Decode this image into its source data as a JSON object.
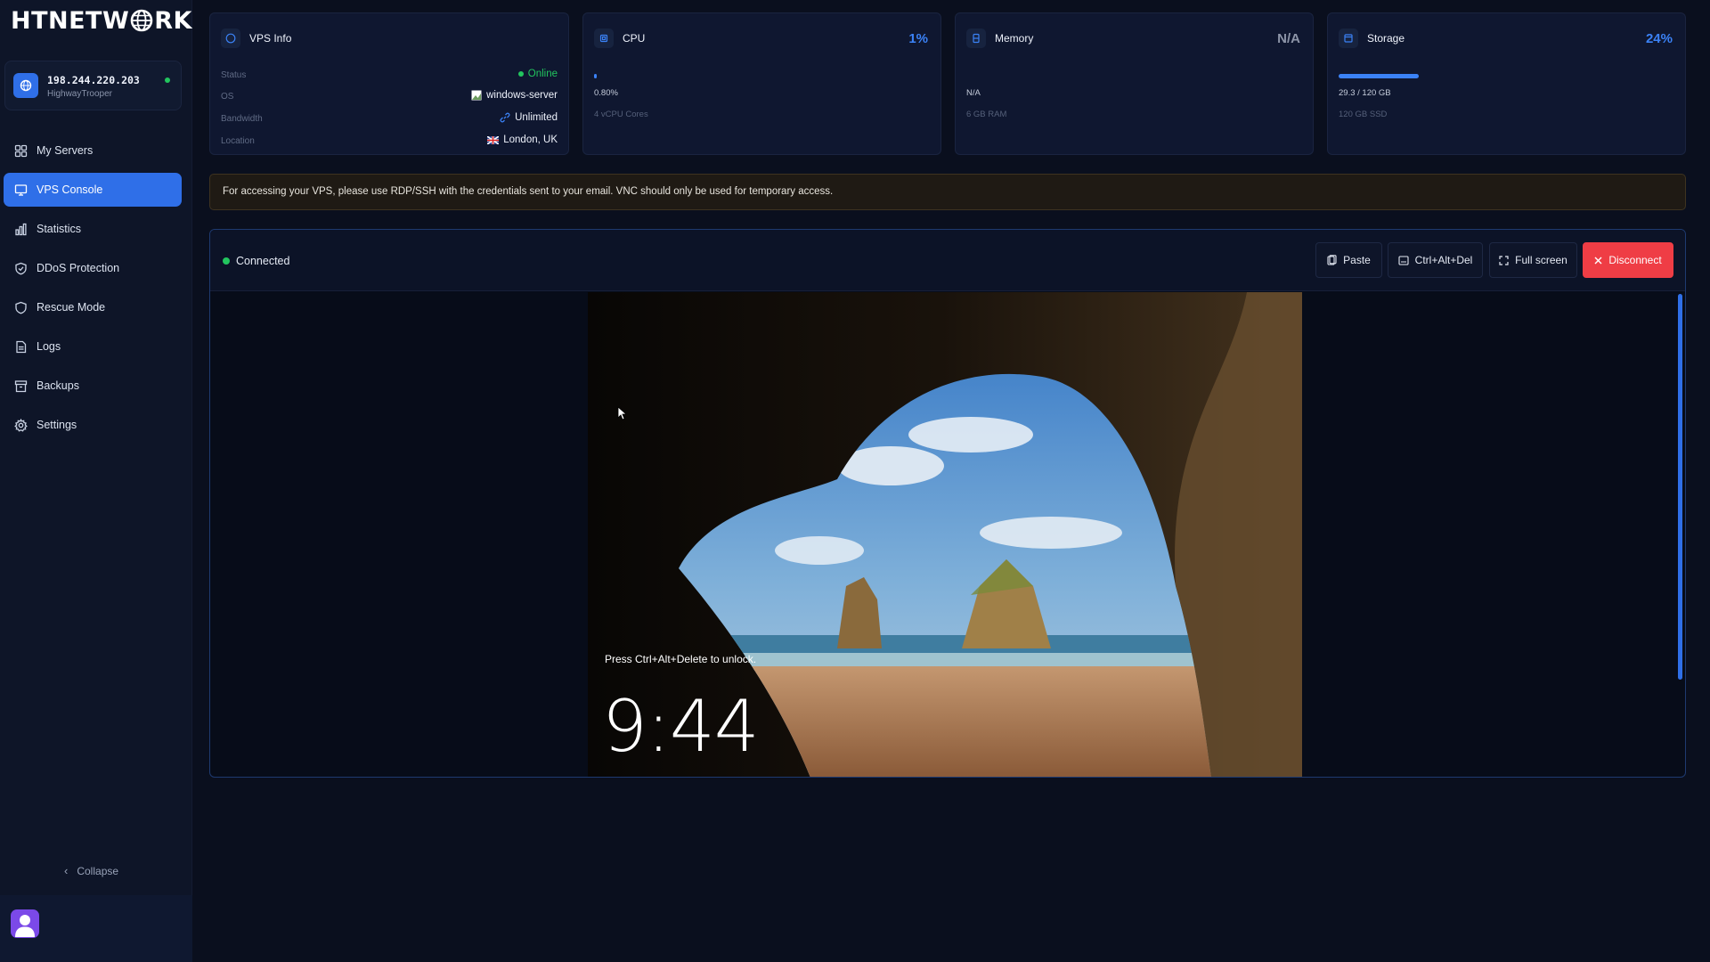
{
  "brand": {
    "logo_pre": "HTNETW",
    "logo_post": "RK"
  },
  "server": {
    "ip": "198.244.220.203",
    "hostname": "HighwayTrooper"
  },
  "nav": [
    {
      "label": "My Servers",
      "icon": "grid-icon"
    },
    {
      "label": "VPS Console",
      "icon": "monitor-icon",
      "active": true
    },
    {
      "label": "Statistics",
      "icon": "bar-chart-icon"
    },
    {
      "label": "DDoS Protection",
      "icon": "shield-icon"
    },
    {
      "label": "Rescue Mode",
      "icon": "shield-alert-icon"
    },
    {
      "label": "Logs",
      "icon": "file-icon"
    },
    {
      "label": "Backups",
      "icon": "archive-icon"
    },
    {
      "label": "Settings",
      "icon": "gear-icon"
    }
  ],
  "collapse_label": "Collapse",
  "vps_info": {
    "title": "VPS Info",
    "rows": [
      {
        "key": "Status",
        "value": "Online"
      },
      {
        "key": "OS",
        "value": "windows-server"
      },
      {
        "key": "Bandwidth",
        "value": "Unlimited"
      },
      {
        "key": "Location",
        "value": "London, UK"
      }
    ]
  },
  "cpu": {
    "title": "CPU",
    "percent": "1%",
    "usage": "0.80%",
    "sub": "4 vCPU Cores",
    "fill": 0.01
  },
  "memory": {
    "title": "Memory",
    "percent": "N/A",
    "usage": "N/A",
    "sub": "6 GB RAM"
  },
  "storage": {
    "title": "Storage",
    "percent": "24%",
    "usage": "29.3 / 120 GB",
    "sub": "120 GB SSD",
    "fill": 0.24
  },
  "notice": "For accessing your VPS, please use RDP/SSH with the credentials sent to your email. VNC should only be used for temporary access.",
  "console": {
    "status": "Connected",
    "buttons": {
      "paste": "Paste",
      "cad": "Ctrl+Alt+Del",
      "fullscreen": "Full screen",
      "disconnect": "Disconnect"
    },
    "lock_text": "Press Ctrl+Alt+Delete to unlock.",
    "time": "9:44"
  },
  "colors": {
    "accent": "#2f6fe8",
    "online": "#22c55e",
    "danger": "#ef3d45",
    "background": "#0a0f1e"
  }
}
